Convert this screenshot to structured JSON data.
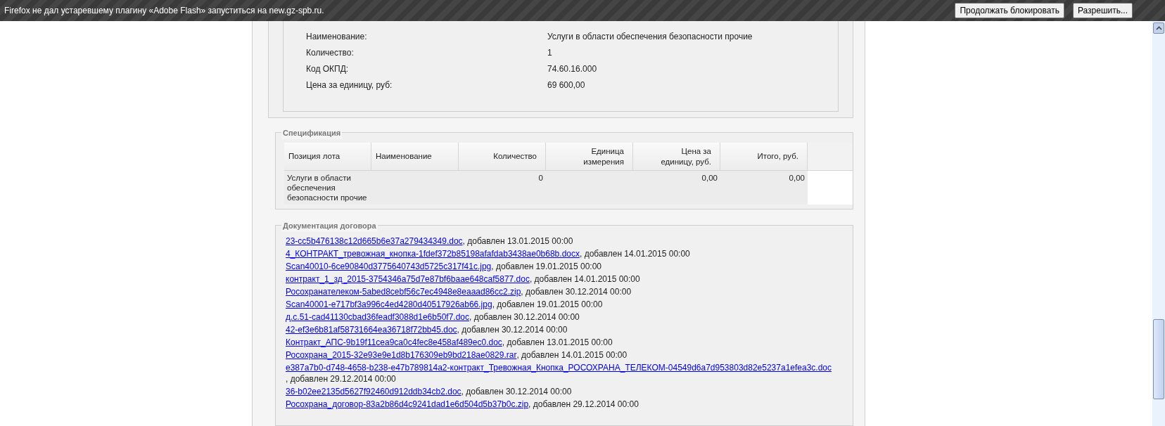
{
  "notification": {
    "message": "Firefox не дал устаревшему плагину «Adobe Flash» запуститься на new.gz-spb.ru.",
    "buttons": [
      "Продолжать блокировать",
      "Разрешить..."
    ]
  },
  "lot_details": [
    {
      "label": "Наименование:",
      "value": "Услуги в области обеспечения безопасности прочие"
    },
    {
      "label": "Количество:",
      "value": "1"
    },
    {
      "label": "Код ОКПД:",
      "value": "74.60.16.000"
    },
    {
      "label": "Цена за единицу, руб:",
      "value": "69 600,00"
    }
  ],
  "specification": {
    "title": "Спецификация",
    "columns": [
      "Позиция лота",
      "Наименование",
      "Количество",
      "Единица измерения",
      "Цена за единицу, руб.",
      "Итого, руб."
    ],
    "rows": [
      [
        "Услуги в области обеспечения безопасности прочие",
        "",
        "0",
        "",
        "0,00",
        "0,00"
      ]
    ]
  },
  "documents": {
    "title": "Документация договора",
    "items": [
      {
        "file": "23-cc5b476138c12d665b6e37a279434349.doc",
        "added": ", добавлен 13.01.2015 00:00"
      },
      {
        "file": "4_КОНТРАКТ_тревожная_кнопка-1fdef372b85198afafdab3438ae0b68b.docx",
        "added": ", добавлен 14.01.2015 00:00"
      },
      {
        "file": "Scan40010-6ce90840d3775640743d5725c317f41c.jpg",
        "added": ", добавлен 19.01.2015 00:00"
      },
      {
        "file": "контракт_1_зд_2015-3754346a75d7e87bf6baae648caf5877.doc",
        "added": ", добавлен 14.01.2015 00:00"
      },
      {
        "file": "Росохранателеком-5abed8cebf56c7ec4948e8eaaad86cc2.zip",
        "added": ", добавлен 30.12.2014 00:00"
      },
      {
        "file": "Scan40001-e717bf3a996c4ed4280d40517926ab66.jpg",
        "added": ", добавлен 19.01.2015 00:00"
      },
      {
        "file": "д.с.51-cad41130cbad36feadf3088d1e6b50f7.doc",
        "added": ", добавлен 30.12.2014 00:00"
      },
      {
        "file": "42-ef3e6b81af58731664ea36718f72bb45.doc",
        "added": ", добавлен 30.12.2014 00:00"
      },
      {
        "file": "Контракт_АПС-9b19f11cea9ca0c4fec8e458af489ec0.doc",
        "added": ", добавлен 13.01.2015 00:00"
      },
      {
        "file": "Росохрана_2015-32e93e9e1d8b176309eb9bd218ae0829.rar",
        "added": ", добавлен 14.01.2015 00:00"
      },
      {
        "file": "e387a7b0-d748-4658-b238-e47b789814a2-контракт_Тревожная_Кнопка_РОСОХРАНА_ТЕЛЕКОМ-04549d6a7d953803d82e5237a1efea3c.doc",
        "added": ", добавлен 29.12.2014 00:00"
      },
      {
        "file": "36-b02ee2135d5627f92460d912ddb34cb2.doc",
        "added": ", добавлен 30.12.2014 00:00"
      },
      {
        "file": "Росохрана_договор-83a2b86d4c9241dad1e6d504d5b37b0c.zip",
        "added": ", добавлен 29.12.2014 00:00"
      }
    ]
  }
}
